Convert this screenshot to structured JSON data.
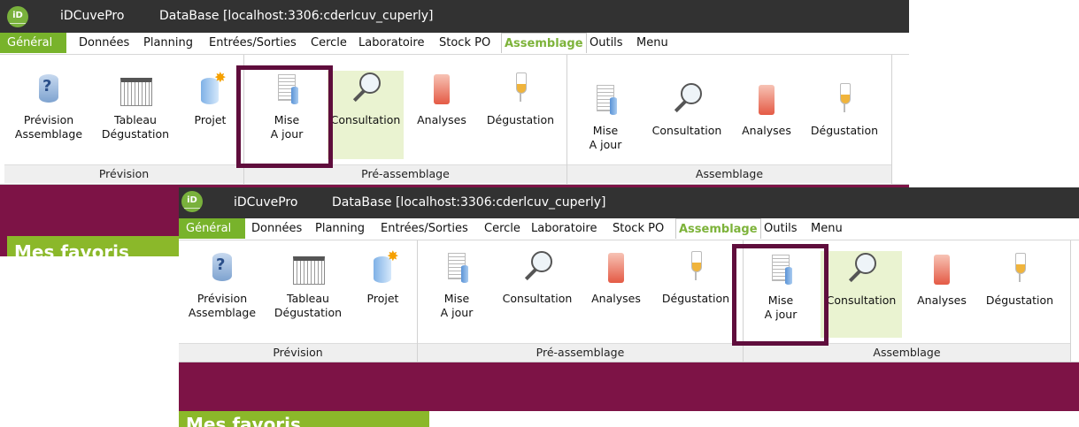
{
  "colors": {
    "titlebar": "#323232",
    "accent_green": "#78b32b",
    "active_tab_text": "#7db33a",
    "highlight_frame": "#5f0d3c",
    "favorites_bar": "#7d1346",
    "favorites_tab": "#8bb82a"
  },
  "window1": {
    "logo": "iD",
    "app_name": "iDCuvePro",
    "db_title": "DataBase [localhost:3306:cderlcuv_cuperly]",
    "menu": {
      "general": "Général",
      "items": [
        "Données",
        "Planning",
        "Entrées/Sorties",
        "Cercle",
        "Laboratoire",
        "Stock PO"
      ],
      "active": "Assemblage",
      "after": [
        "Outils",
        "Menu"
      ]
    },
    "groups": {
      "prevision": {
        "label": "Prévision",
        "buttons": [
          {
            "line1": "Prévision",
            "line2": "Assemblage",
            "icon": "question-cylinder-icon"
          },
          {
            "line1": "Tableau",
            "line2": "Dégustation",
            "icon": "table-icon"
          },
          {
            "line1": "Projet",
            "line2": "",
            "icon": "project-icon"
          }
        ]
      },
      "pre_assemblage": {
        "label": "Pré-assemblage",
        "buttons": [
          {
            "line1": "Mise",
            "line2": "A jour",
            "icon": "document-icon"
          },
          {
            "line1": "Consultation",
            "line2": "",
            "icon": "magnifier-icon"
          },
          {
            "line1": "Analyses",
            "line2": "",
            "icon": "beaker-icon"
          },
          {
            "line1": "Dégustation",
            "line2": "",
            "icon": "wine-glass-icon"
          }
        ]
      },
      "assemblage": {
        "label": "Assemblage",
        "buttons": [
          {
            "line1": "Mise",
            "line2": "A jour",
            "icon": "document-icon"
          },
          {
            "line1": "Consultation",
            "line2": "",
            "icon": "magnifier-icon"
          },
          {
            "line1": "Analyses",
            "line2": "",
            "icon": "beaker-icon"
          },
          {
            "line1": "Dégustation",
            "line2": "",
            "icon": "wine-glass-icon"
          }
        ]
      }
    },
    "favorites_label": "Mes favoris"
  },
  "window2": {
    "logo": "iD",
    "app_name": "iDCuvePro",
    "db_title": "DataBase [localhost:3306:cderlcuv_cuperly]",
    "menu": {
      "general": "Général",
      "items": [
        "Données",
        "Planning",
        "Entrées/Sorties",
        "Cercle",
        "Laboratoire",
        "Stock PO"
      ],
      "active": "Assemblage",
      "after": [
        "Outils",
        "Menu"
      ]
    },
    "groups": {
      "prevision": {
        "label": "Prévision",
        "buttons": [
          {
            "line1": "Prévision",
            "line2": "Assemblage",
            "icon": "question-cylinder-icon"
          },
          {
            "line1": "Tableau",
            "line2": "Dégustation",
            "icon": "table-icon"
          },
          {
            "line1": "Projet",
            "line2": "",
            "icon": "project-icon"
          }
        ]
      },
      "pre_assemblage": {
        "label": "Pré-assemblage",
        "buttons": [
          {
            "line1": "Mise",
            "line2": "A jour",
            "icon": "document-icon"
          },
          {
            "line1": "Consultation",
            "line2": "",
            "icon": "magnifier-icon"
          },
          {
            "line1": "Analyses",
            "line2": "",
            "icon": "beaker-icon"
          },
          {
            "line1": "Dégustation",
            "line2": "",
            "icon": "wine-glass-icon"
          }
        ]
      },
      "assemblage": {
        "label": "Assemblage",
        "buttons": [
          {
            "line1": "Mise",
            "line2": "A jour",
            "icon": "document-icon"
          },
          {
            "line1": "Consultation",
            "line2": "",
            "icon": "magnifier-icon"
          },
          {
            "line1": "Analyses",
            "line2": "",
            "icon": "beaker-icon"
          },
          {
            "line1": "Dégustation",
            "line2": "",
            "icon": "wine-glass-icon"
          }
        ]
      }
    },
    "favorites_label": "Mes favoris"
  }
}
